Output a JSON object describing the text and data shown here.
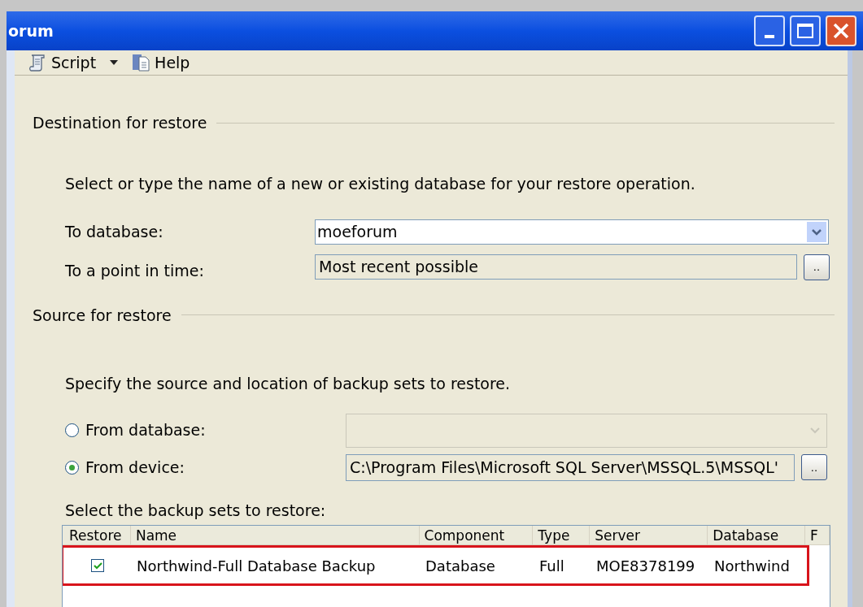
{
  "window": {
    "title": "orum"
  },
  "toolbar": {
    "items": [
      {
        "kind": "script",
        "label": "Script"
      },
      {
        "kind": "help",
        "label": "Help"
      }
    ]
  },
  "destination": {
    "heading": "Destination for restore",
    "instruction": "Select or type the name of a new or existing database for your restore operation.",
    "to_database": {
      "label": "To database:",
      "value": "moeforum"
    },
    "point_in_time": {
      "label": "To a point in time:",
      "value": "Most recent possible",
      "button": ".."
    }
  },
  "source": {
    "heading": "Source for restore",
    "instruction": "Specify the source and location of backup sets to restore.",
    "options": [
      {
        "label": "From database:",
        "selected": false,
        "kind": "dropdown"
      },
      {
        "label": "From device:",
        "selected": true,
        "kind": "path",
        "value": "C:\\Program Files\\Microsoft SQL Server\\MSSQL.5\\MSSQL'",
        "button": ".."
      }
    ]
  },
  "backup_sets": {
    "label": "Select the backup sets to restore:",
    "columns": [
      "Restore",
      "Name",
      "Component",
      "Type",
      "Server",
      "Database",
      "F"
    ],
    "rows": [
      {
        "checked": true,
        "highlighted": true,
        "cells": [
          "",
          "Northwind-Full Database Backup",
          "Database",
          "Full",
          "MOE8378199",
          "Northwind"
        ]
      }
    ]
  }
}
